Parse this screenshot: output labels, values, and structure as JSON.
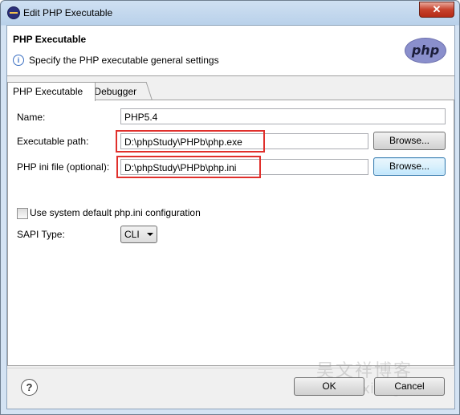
{
  "window": {
    "title": "Edit PHP Executable",
    "close_glyph": "✕"
  },
  "header": {
    "title": "PHP Executable",
    "description": "Specify the PHP executable general settings",
    "logo_text": "php",
    "info_glyph": "i"
  },
  "tabs": [
    {
      "label": "PHP Executable",
      "active": true
    },
    {
      "label": "Debugger",
      "active": false
    }
  ],
  "form": {
    "name": {
      "label": "Name:",
      "value": "PHP5.4"
    },
    "executable_path": {
      "label": "Executable path:",
      "value": "D:\\phpStudy\\PHPb\\php.exe",
      "browse_label": "Browse..."
    },
    "ini_file": {
      "label": "PHP ini file (optional):",
      "value": "D:\\phpStudy\\PHPb\\php.ini",
      "browse_label": "Browse..."
    },
    "use_default_ini": {
      "label": "Use system default php.ini configuration",
      "checked": false
    },
    "sapi_type": {
      "label": "SAPI Type:",
      "value": "CLI"
    }
  },
  "footer": {
    "help_glyph": "?",
    "ok_label": "OK",
    "cancel_label": "Cancel"
  },
  "watermark": {
    "line1": "吴文祥博客",
    "line2": "wuwenxiang.cn"
  },
  "colors": {
    "highlight": "#e0302c",
    "logo": "#8a8fcc"
  }
}
